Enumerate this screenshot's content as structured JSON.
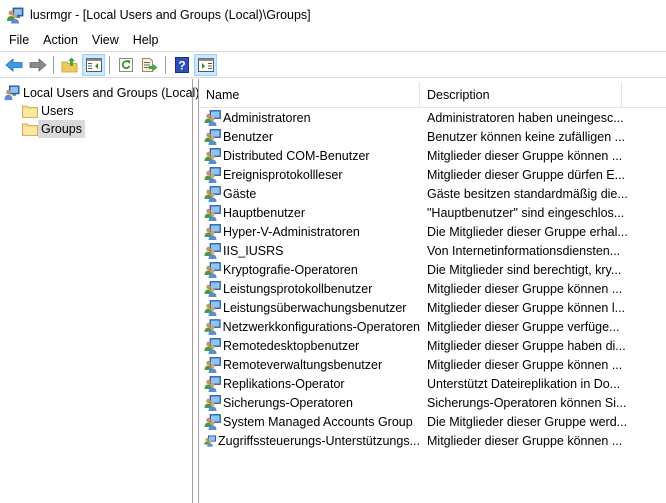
{
  "window": {
    "title": "lusrmgr - [Local Users and Groups (Local)\\Groups]",
    "app_icon": "users-computer-icon"
  },
  "menubar": {
    "items": [
      "File",
      "Action",
      "View",
      "Help"
    ]
  },
  "toolbar": {
    "buttons": [
      {
        "name": "back",
        "icon": "back-arrow-icon",
        "active": false
      },
      {
        "name": "forward",
        "icon": "forward-arrow-icon",
        "active": false
      },
      {
        "name": "up-one-level",
        "icon": "up-folder-icon",
        "active": false
      },
      {
        "name": "show-hide-console-tree",
        "icon": "console-tree-icon",
        "active": true
      },
      {
        "name": "refresh",
        "icon": "refresh-icon",
        "active": false
      },
      {
        "name": "export-list",
        "icon": "export-list-icon",
        "active": false
      },
      {
        "name": "help",
        "icon": "help-icon",
        "active": false
      },
      {
        "name": "show-hide-action-pane",
        "icon": "action-pane-icon",
        "active": true
      }
    ]
  },
  "tree": {
    "root": {
      "label": "Local Users and Groups (Local)",
      "icon": "users-computer-icon"
    },
    "children": [
      {
        "label": "Users",
        "icon": "folder-icon",
        "selected": false
      },
      {
        "label": "Groups",
        "icon": "folder-icon",
        "selected": true
      }
    ]
  },
  "list": {
    "columns": {
      "name": "Name",
      "description": "Description"
    },
    "rows": [
      {
        "name": "Administratoren",
        "description": "Administratoren haben uneingesc..."
      },
      {
        "name": "Benutzer",
        "description": "Benutzer können keine zufälligen ..."
      },
      {
        "name": "Distributed COM-Benutzer",
        "description": "Mitglieder dieser Gruppe können ..."
      },
      {
        "name": "Ereignisprotokollleser",
        "description": "Mitglieder dieser Gruppe dürfen E..."
      },
      {
        "name": "Gäste",
        "description": "Gäste besitzen standardmäßig die..."
      },
      {
        "name": "Hauptbenutzer",
        "description": "\"Hauptbenutzer\" sind eingeschlos..."
      },
      {
        "name": "Hyper-V-Administratoren",
        "description": "Die Mitglieder dieser Gruppe erhal..."
      },
      {
        "name": "IIS_IUSRS",
        "description": "Von Internetinformationsdiensten..."
      },
      {
        "name": "Kryptografie-Operatoren",
        "description": "Die Mitglieder sind berechtigt, kry..."
      },
      {
        "name": "Leistungsprotokollbenutzer",
        "description": "Mitglieder dieser Gruppe können ..."
      },
      {
        "name": "Leistungsüberwachungsbenutzer",
        "description": "Mitglieder dieser Gruppe können l..."
      },
      {
        "name": "Netzwerkkonfigurations-Operatoren",
        "description": "Mitglieder dieser Gruppe verfüge..."
      },
      {
        "name": "Remotedesktopbenutzer",
        "description": "Mitglieder dieser Gruppe haben di..."
      },
      {
        "name": "Remoteverwaltungsbenutzer",
        "description": "Mitglieder dieser Gruppe können ..."
      },
      {
        "name": "Replikations-Operator",
        "description": "Unterstützt Dateireplikation in Do..."
      },
      {
        "name": "Sicherungs-Operatoren",
        "description": "Sicherungs-Operatoren können Si..."
      },
      {
        "name": "System Managed Accounts Group",
        "description": "Die Mitglieder dieser Gruppe werd..."
      },
      {
        "name": "Zugriffssteuerungs-Unterstützungs...",
        "description": "Mitglieder dieser Gruppe können ..."
      }
    ]
  }
}
